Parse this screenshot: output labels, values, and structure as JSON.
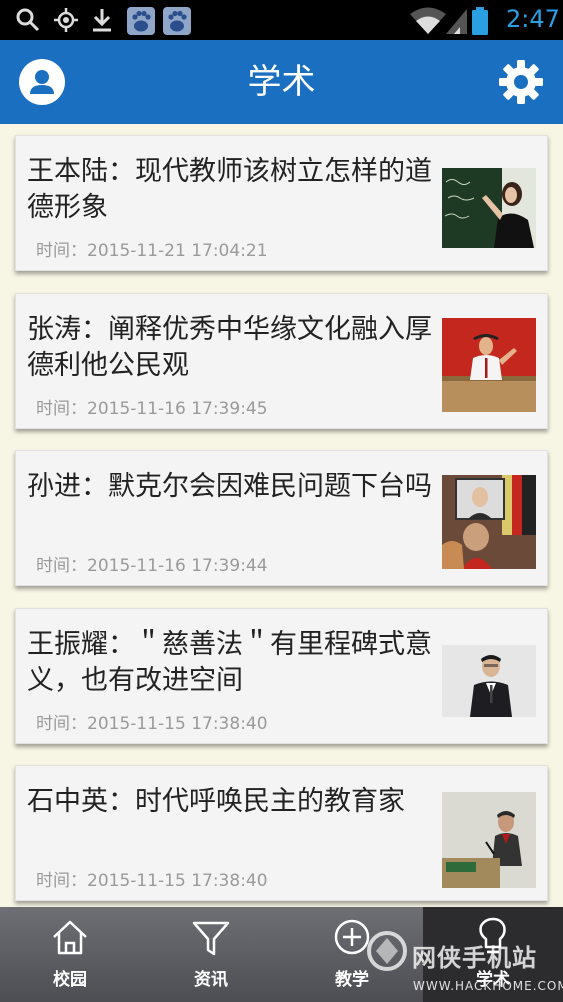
{
  "status_bar": {
    "time": "2:47",
    "icons": [
      "search-icon",
      "gps-icon",
      "download-icon",
      "baidu-paw-icon",
      "baidu-paw-icon",
      "wifi-icon",
      "cell-signal-icon",
      "battery-icon"
    ]
  },
  "app_bar": {
    "title": "学术",
    "left_icon": "user-avatar-icon",
    "right_icon": "gear-icon",
    "color": "#1b6fc1"
  },
  "articles": [
    {
      "title": "王本陆：现代教师该树立怎样的道德形象",
      "time": "时间：2015-11-21 17:04:21",
      "thumb": "teacher-at-blackboard-photo"
    },
    {
      "title": "张涛：阐释优秀中华缘文化融入厚德利他公民观",
      "time": "时间：2015-11-16 17:39:45",
      "thumb": "speaker-at-podium-photo"
    },
    {
      "title": "孙进：默克尔会因难民问题下台吗",
      "time": "时间：2015-11-16 17:39:44",
      "thumb": "refugee-selfie-photo"
    },
    {
      "title": "王振耀：＂慈善法＂有里程碑式意义，也有改进空间",
      "time": "时间：2015-11-15 17:38:40",
      "thumb": "man-in-suit-photo"
    },
    {
      "title": "石中英：时代呼唤民主的教育家",
      "time": "时间：2015-11-15 17:38:40",
      "thumb": "lecturer-at-lectern-photo"
    }
  ],
  "bottom_nav": {
    "tabs": [
      {
        "label": "校园",
        "icon": "home-icon"
      },
      {
        "label": "资讯",
        "icon": "filter-icon"
      },
      {
        "label": "教学",
        "icon": "plus-circle-icon"
      },
      {
        "label": "学术",
        "icon": "bulb-icon"
      }
    ],
    "active_index": 3
  },
  "watermark": {
    "cn": "网侠手机站",
    "url": "WWW.HACKHOME.COM"
  }
}
